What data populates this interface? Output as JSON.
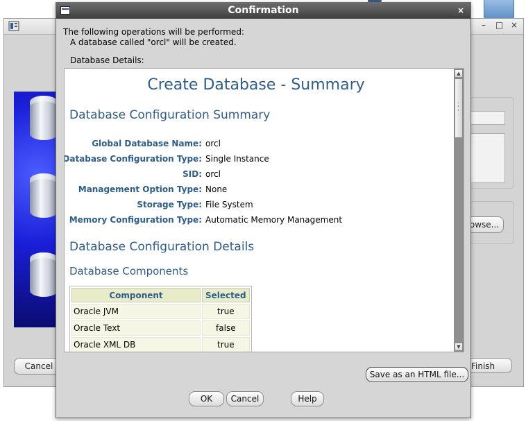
{
  "background_window": {
    "minimize": "–",
    "maximize": "□",
    "close": "×",
    "browse_label": "owse...",
    "cancel_label": "Cancel",
    "finish_label": "Finish"
  },
  "dialog": {
    "title": "Confirmation",
    "close": "×",
    "intro_line1": "The following operations will be performed:",
    "intro_line2": "A database called \"orcl\" will be created.",
    "details_label": "Database Details:",
    "summary": {
      "title": "Create Database - Summary",
      "config_summary_heading": "Database Configuration Summary",
      "fields": [
        {
          "label": "Global Database Name:",
          "value": "orcl"
        },
        {
          "label": "Database Configuration Type:",
          "value": "Single Instance"
        },
        {
          "label": "SID:",
          "value": "orcl"
        },
        {
          "label": "Management Option Type:",
          "value": "None"
        },
        {
          "label": "Storage Type:",
          "value": "File System"
        },
        {
          "label": "Memory Configuration Type:",
          "value": "Automatic Memory Management"
        }
      ],
      "config_details_heading": "Database Configuration Details",
      "components_heading": "Database Components",
      "components_table": {
        "headers": [
          "Component",
          "Selected"
        ],
        "rows": [
          [
            "Oracle JVM",
            "true"
          ],
          [
            "Oracle Text",
            "false"
          ],
          [
            "Oracle XML DB",
            "true"
          ]
        ]
      }
    },
    "save_html_label": "Save as an HTML file...",
    "ok_label": "OK",
    "cancel_label": "Cancel",
    "help_label": "Help"
  }
}
